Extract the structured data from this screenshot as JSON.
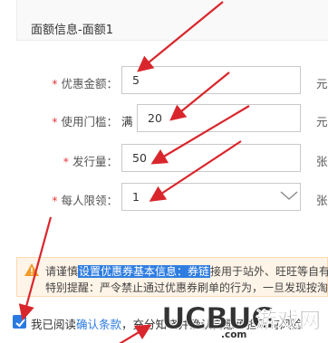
{
  "section": {
    "title": "面额信息-面额1"
  },
  "form": {
    "required_mark": "*",
    "discount_amount": {
      "label": "优惠金额：",
      "value": "5",
      "suffix": "元"
    },
    "threshold": {
      "label": "使用门槛：",
      "prefix": "满",
      "value": "20",
      "suffix": "元"
    },
    "issue_quantity": {
      "label": "发行量：",
      "value": "50",
      "suffix": "张"
    },
    "per_person_limit": {
      "label": "每人限领：",
      "value": "1",
      "suffix": "张"
    }
  },
  "notice": {
    "line1_before": "请谨慎",
    "line1_highlight": "设置优惠券基本信息：券链",
    "line1_after": "接用于站外、旺旺等自有",
    "line2": "特别提醒：严令禁止通过优惠券刷单的行为，一旦发现按淘"
  },
  "agreement": {
    "before": "我已阅读",
    "link": "确认条款",
    "after": "，充分知晓并确认自愿承担所有风险"
  },
  "watermark": {
    "brand": "UCBUG",
    "cn": "游戏网",
    "domain": ".com"
  },
  "colors": {
    "arrow": "#d9262c",
    "accent": "#2a7ae2",
    "required": "#e4393c"
  }
}
